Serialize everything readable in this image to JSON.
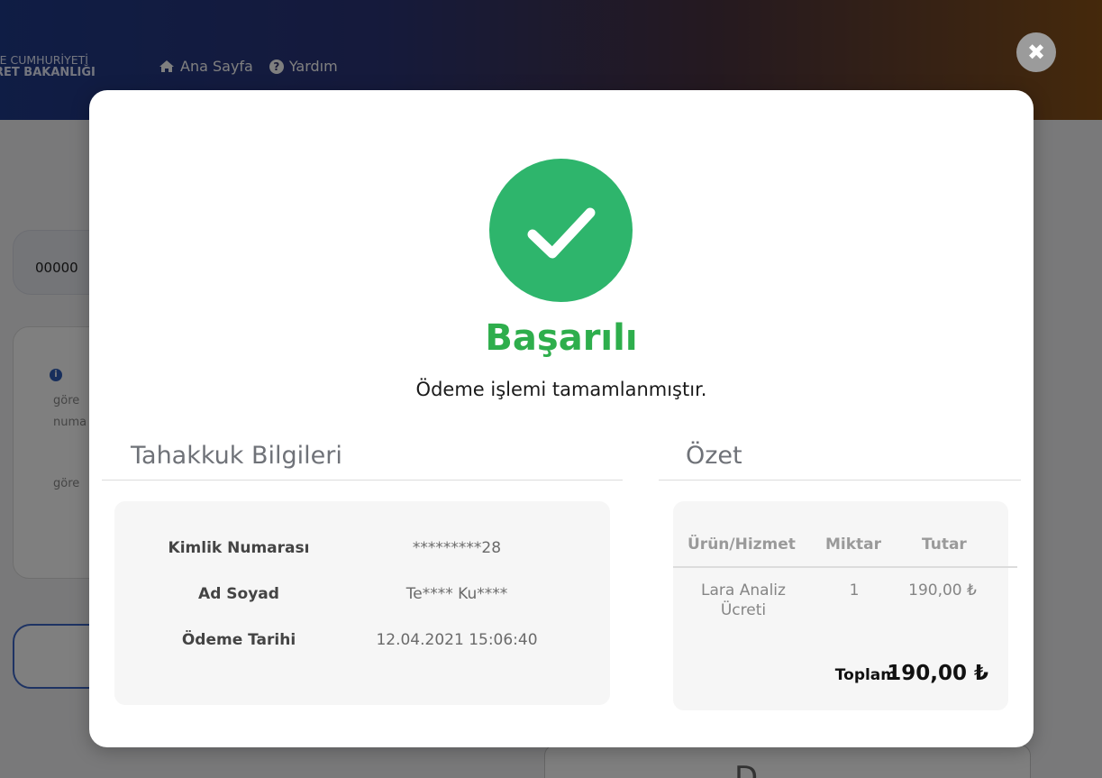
{
  "header": {
    "ministry_line1": "YE CUMHURİYETİ",
    "ministry_line2": "RET BAKANLIĞI",
    "nav": [
      {
        "label": "Ana Sayfa",
        "icon": "home-icon"
      },
      {
        "label": "Yardım",
        "icon": "help-icon"
      }
    ]
  },
  "background": {
    "field_value": "00000",
    "info_lines": [
      "göre",
      "numa",
      "göre"
    ],
    "card_partial_text": "D"
  },
  "modal": {
    "close_symbol": "✖",
    "status_title": "Başarılı",
    "status_message": "Ödeme işlemi tamamlanmıştır.",
    "accrual": {
      "heading": "Tahakkuk Bilgileri",
      "rows": [
        {
          "label": "Kimlik Numarası",
          "value": "*********28"
        },
        {
          "label": "Ad Soyad",
          "value": "Te**** Ku****"
        },
        {
          "label": "Ödeme Tarihi",
          "value": "12.04.2021 15:06:40"
        }
      ]
    },
    "summary": {
      "heading": "Özet",
      "columns": [
        "Ürün/Hizmet",
        "Miktar",
        "Tutar"
      ],
      "items": [
        {
          "name_line1": "Lara Analiz",
          "name_line2": "Ücreti",
          "quantity": "1",
          "amount": "190,00 ₺"
        }
      ],
      "total_label": "Toplam",
      "total_value": "190,00 ₺"
    }
  },
  "colors": {
    "success_green": "#2eb56c",
    "title_green": "#2eae4c",
    "header_blue": "#1f3a8a",
    "header_orange": "#8a5217"
  }
}
